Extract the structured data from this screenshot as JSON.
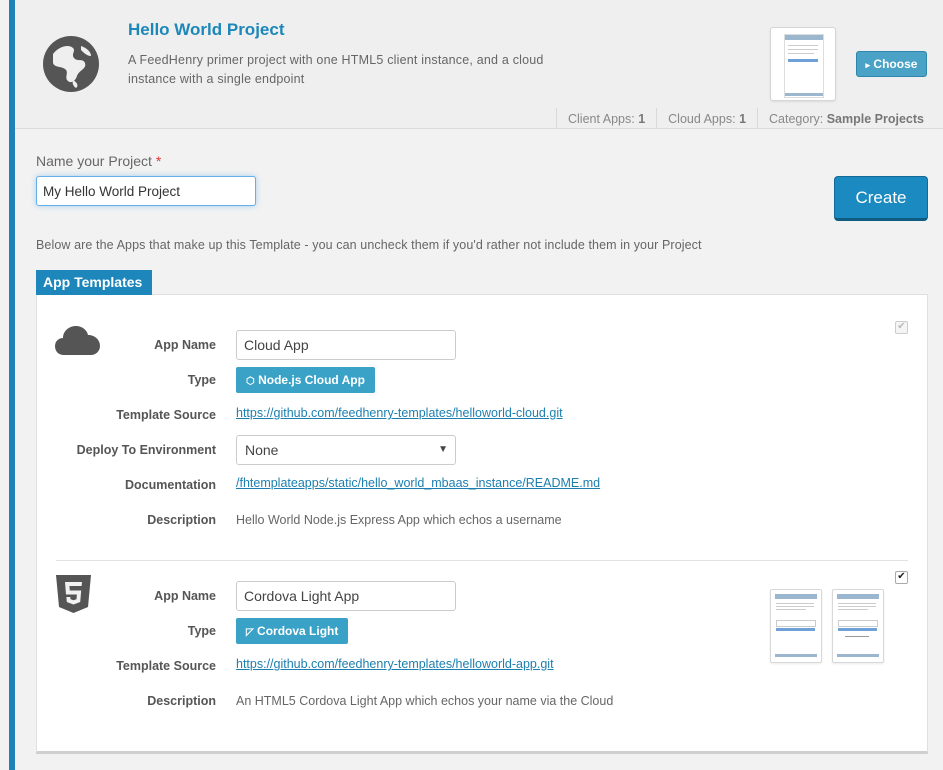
{
  "project": {
    "title": "Hello World Project",
    "description": "A FeedHenry primer project with one HTML5 client instance, and a cloud instance with a single endpoint",
    "choose_label": "Choose",
    "stats": {
      "client_label": "Client Apps:",
      "client_value": "1",
      "cloud_label": "Cloud Apps:",
      "cloud_value": "1",
      "category_label": "Category:",
      "category_value": "Sample Projects"
    }
  },
  "form": {
    "name_label": "Name your Project",
    "required_mark": "*",
    "name_value": "My Hello World Project",
    "create_label": "Create",
    "info_text": "Below are the Apps that make up this Template - you can uncheck them if you'd rather not include them in your Project"
  },
  "templates": {
    "tab_label": "App Templates",
    "labels": {
      "app_name": "App Name",
      "type": "Type",
      "template_source": "Template Source",
      "deploy_env": "Deploy To Environment",
      "documentation": "Documentation",
      "description": "Description"
    },
    "cloud": {
      "icon": "cloud-icon",
      "app_name": "Cloud App",
      "type": "Node.js Cloud App",
      "source": "https://github.com/feedhenry-templates/helloworld-cloud.git",
      "environment": "None",
      "documentation": "/fhtemplateapps/static/hello_world_mbaas_instance/README.md",
      "description": "Hello World Node.js Express App which echos a username",
      "checked": true
    },
    "client": {
      "icon": "html5-icon",
      "app_name": "Cordova Light App",
      "type": "Cordova Light",
      "source": "https://github.com/feedhenry-templates/helloworld-app.git",
      "description": "An HTML5 Cordova Light App which echos your name via the Cloud",
      "checked": true
    }
  },
  "colors": {
    "accent": "#1d86bb",
    "badge": "#3aa2c6",
    "link": "#1c7fb0"
  }
}
